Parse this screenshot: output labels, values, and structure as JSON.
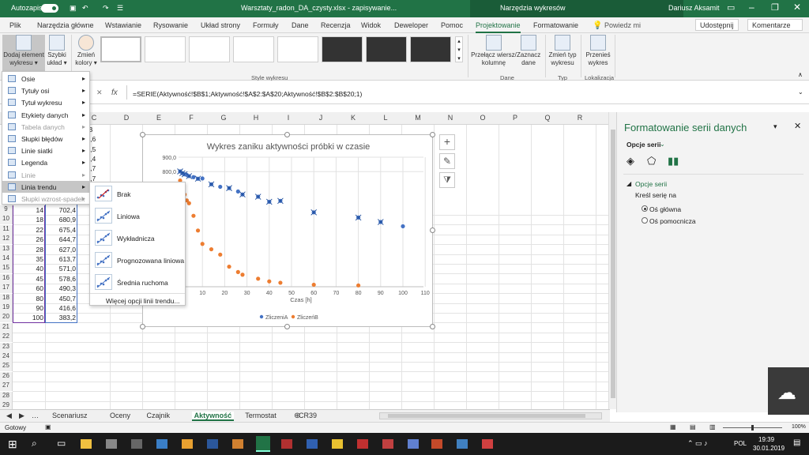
{
  "titlebar": {
    "autosave_label": "Autozapis",
    "file_title": "Warsztaty_radon_DA_czysty.xlsx - zapisywanie...",
    "contextual_title": "Narzędzia wykresów",
    "user_name": "Dariusz Aksamit"
  },
  "menu": {
    "items": [
      "Plik",
      "Narzędzia główne",
      "Wstawianie",
      "Rysowanie",
      "Układ strony",
      "Formuły",
      "Dane",
      "Recenzja",
      "Widok",
      "Deweloper",
      "Pomoc",
      "Projektowanie",
      "Formatowanie"
    ],
    "active": "Projektowanie",
    "search": "Powiedz mi",
    "share": "Udostępnij",
    "comments": "Komentarze"
  },
  "ribbon": {
    "add_element": [
      "Dodaj element",
      "wykresu ▾"
    ],
    "quick_layout": [
      "Szybki",
      "układ ▾"
    ],
    "change_colors": [
      "Zmień",
      "kolory ▾"
    ],
    "styles_label": "Style wykresu",
    "switch_row_col": [
      "Przełącz wiersz/",
      "kolumnę"
    ],
    "select_data": [
      "Zaznacz",
      "dane"
    ],
    "data_group": "Dane",
    "change_type": [
      "Zmień typ",
      "wykresu"
    ],
    "type_group": "Typ",
    "move_chart": [
      "Przenieś",
      "wykres"
    ],
    "location_group": "Lokalizacja"
  },
  "formula": {
    "fx": "fx",
    "text": "=SERIE(Aktywność!$B$1;Aktywność!$A$2:$A$20;Aktywność!$B$2:$B$20;1)"
  },
  "columns": [
    "C",
    "D",
    "E",
    "F",
    "G",
    "H",
    "I",
    "J",
    "K",
    "L",
    "M",
    "N",
    "O",
    "P",
    "Q",
    "R"
  ],
  "rows_top": [
    {
      "c": "zerB"
    },
    {
      "c": "794,6"
    },
    {
      "c": "742,5"
    },
    {
      "c": "689,4"
    },
    {
      "c": "645,7"
    },
    {
      "c": "624,7"
    }
  ],
  "rows": [
    {
      "n": "9",
      "a": "14",
      "b": "702,4"
    },
    {
      "n": "10",
      "a": "18",
      "b": "680,9"
    },
    {
      "n": "11",
      "a": "22",
      "b": "675,4"
    },
    {
      "n": "12",
      "a": "26",
      "b": "644,7"
    },
    {
      "n": "13",
      "a": "28",
      "b": "627,0"
    },
    {
      "n": "14",
      "a": "35",
      "b": "613,7"
    },
    {
      "n": "15",
      "a": "40",
      "b": "571,0"
    },
    {
      "n": "16",
      "a": "45",
      "b": "578,6"
    },
    {
      "n": "17",
      "a": "60",
      "b": "490,3"
    },
    {
      "n": "18",
      "a": "80",
      "b": "450,7"
    },
    {
      "n": "19",
      "a": "90",
      "b": "416,6"
    },
    {
      "n": "20",
      "a": "100",
      "b": "383,2"
    },
    {
      "n": "21"
    },
    {
      "n": "22"
    },
    {
      "n": "23"
    },
    {
      "n": "24"
    },
    {
      "n": "25"
    },
    {
      "n": "26"
    },
    {
      "n": "27"
    },
    {
      "n": "28"
    },
    {
      "n": "29"
    }
  ],
  "add_element_menu": [
    {
      "label": "Osie",
      "enabled": true,
      "arrow": true
    },
    {
      "label": "Tytuły osi",
      "enabled": true,
      "arrow": true
    },
    {
      "label": "Tytuł wykresu",
      "enabled": true,
      "arrow": true
    },
    {
      "label": "Etykiety danych",
      "enabled": true,
      "arrow": true
    },
    {
      "label": "Tabela danych",
      "enabled": false,
      "arrow": true
    },
    {
      "label": "Słupki błędów",
      "enabled": true,
      "arrow": true
    },
    {
      "label": "Linie siatki",
      "enabled": true,
      "arrow": true
    },
    {
      "label": "Legenda",
      "enabled": true,
      "arrow": true
    },
    {
      "label": "Linie",
      "enabled": false,
      "arrow": true
    },
    {
      "label": "Linia trendu",
      "enabled": true,
      "arrow": true,
      "highlighted": true
    },
    {
      "label": "Słupki wzrost-spadek",
      "enabled": false,
      "arrow": true
    }
  ],
  "trendline_menu": [
    "Brak",
    "Liniowa",
    "Wykładnicza",
    "Prognozowana liniowa",
    "Średnia ruchoma"
  ],
  "trendline_more": "Więcej opcji linii trendu...",
  "chart_data": {
    "type": "scatter",
    "title": "Wykres zaniku aktywności próbki w czasie",
    "xlabel": "Czas [h]",
    "ylabel": "",
    "xlim": [
      0,
      110
    ],
    "ylim": [
      0,
      900
    ],
    "x_ticks": [
      "10",
      "20",
      "30",
      "40",
      "50",
      "60",
      "70",
      "80",
      "90",
      "100",
      "110"
    ],
    "y_ticks": [
      "800,0",
      "900,0"
    ],
    "legend_placement": "bottom",
    "series": [
      {
        "name": "ZliczeniA",
        "color": "#4472c4",
        "x": [
          0,
          1,
          2,
          3,
          4,
          6,
          8,
          10,
          14,
          18,
          22,
          26,
          28,
          35,
          40,
          45,
          60,
          80,
          90,
          100
        ],
        "y": [
          804,
          790,
          782,
          777,
          768,
          760,
          748,
          750,
          705,
          686,
          676,
          650,
          627,
          610,
          571,
          578,
          490,
          450,
          416,
          383
        ]
      },
      {
        "name": "ZliczeńB",
        "color": "#ed7d31",
        "selected": true,
        "x": [
          0,
          1,
          2,
          3,
          4,
          6,
          8,
          10,
          14,
          18,
          22,
          26,
          28,
          35,
          40,
          45,
          60,
          80
        ],
        "y": [
          794,
          742,
          689,
          645,
          624,
          530,
          420,
          320,
          280,
          240,
          150,
          110,
          90,
          60,
          40,
          30,
          15,
          10
        ]
      }
    ]
  },
  "pane": {
    "title": "Formatowanie serii danych",
    "dropdown": "Opcje serii",
    "section": "Opcje serii",
    "plot_on": "Kreśl serię na",
    "primary": "Oś główna",
    "secondary": "Oś pomocnicza"
  },
  "sheets": [
    "Scenariusz",
    "Oceny",
    "Czajnik",
    "Aktywność",
    "Termostat",
    "CR39"
  ],
  "active_sheet": "Aktywność",
  "status": {
    "ready": "Gotowy",
    "zoom": "100%"
  },
  "taskbar": {
    "lang": "POL",
    "time": "19:39",
    "date": "30.01.2019"
  }
}
